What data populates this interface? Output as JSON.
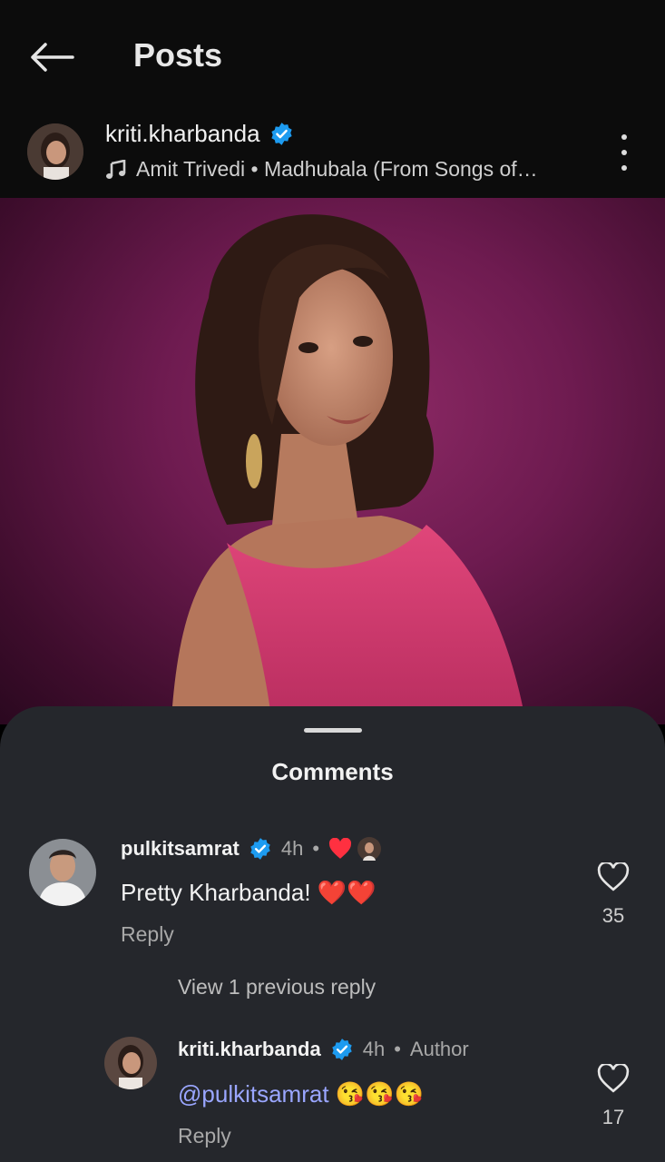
{
  "header": {
    "title": "Posts",
    "back_icon": "arrow-left-icon"
  },
  "post": {
    "username": "kriti.kharbanda",
    "verified": true,
    "music_icon": "music-note-icon",
    "music_text": "Amit Trivedi • Madhubala (From Songs of…",
    "more_icon": "more-vertical-icon"
  },
  "comments_sheet": {
    "title": "Comments",
    "view_replies_label": "View 1 previous reply",
    "comments": [
      {
        "username": "pulkitsamrat",
        "verified": true,
        "time": "4h",
        "separator": "•",
        "liked_by_author": true,
        "text": "Pretty Kharbanda! ❤️❤️",
        "reply_label": "Reply",
        "like_count": "35"
      },
      {
        "username": "kriti.kharbanda",
        "verified": true,
        "time": "4h",
        "separator": "•",
        "author_label": "Author",
        "mention": "@pulkitsamrat",
        "text": " 😘😘😘",
        "reply_label": "Reply",
        "like_count": "17"
      }
    ]
  },
  "colors": {
    "verified_blue": "#1d9bf0",
    "sheet_bg": "#25272c",
    "mention": "#9aa6ff",
    "heart_red": "#ff3040"
  }
}
